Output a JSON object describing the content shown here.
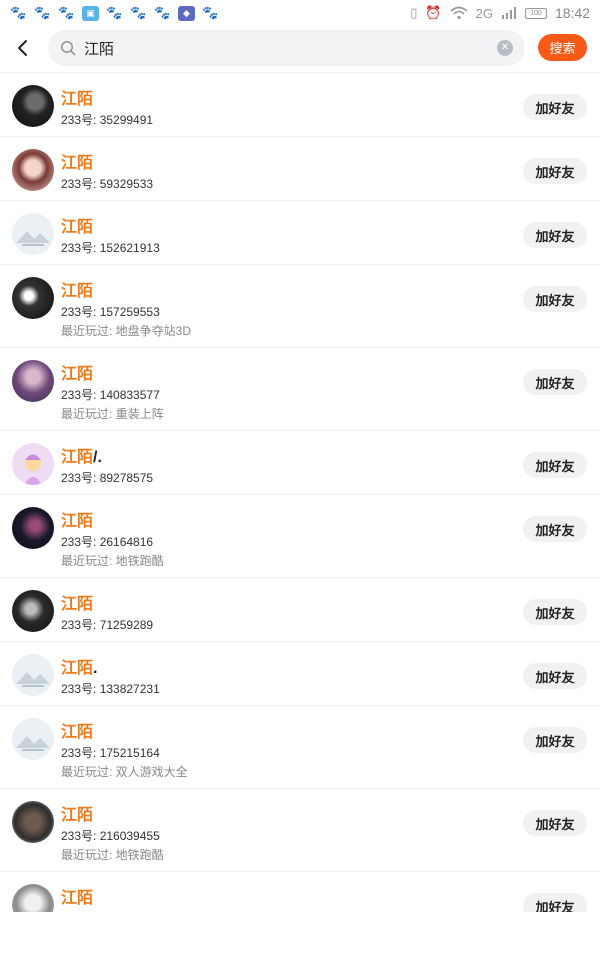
{
  "status_bar": {
    "notifications": [
      "paw-icon",
      "paw-icon",
      "paw-icon",
      "image-app-icon",
      "paw-icon",
      "paw-icon",
      "paw-icon",
      "cube-app-icon",
      "paw-icon"
    ],
    "battery": "100",
    "network": "2G",
    "time": "18:42"
  },
  "search": {
    "query": "江陌",
    "button_label": "搜索"
  },
  "results": [
    {
      "name": "江陌",
      "suffix": "",
      "uid": "233号: 35299491",
      "recent": "",
      "add_label": "加好友",
      "avatar": "dark-anime-avatar"
    },
    {
      "name": "江陌",
      "suffix": "",
      "uid": "233号: 59329533",
      "recent": "",
      "add_label": "加好友",
      "avatar": "anime-girl-avatar"
    },
    {
      "name": "江陌",
      "suffix": "",
      "uid": "233号: 152621913",
      "recent": "",
      "add_label": "加好友",
      "avatar": "default-avatar"
    },
    {
      "name": "江陌",
      "suffix": "",
      "uid": "233号: 157259553",
      "recent": "最近玩过: 地盘争夺站3D",
      "add_label": "加好友",
      "avatar": "dark-anime-avatar"
    },
    {
      "name": "江陌",
      "suffix": "",
      "uid": "233号: 140833577",
      "recent": "最近玩过: 重装上阵",
      "add_label": "加好友",
      "avatar": "purple-anime-avatar"
    },
    {
      "name": "江陌",
      "suffix": "/.",
      "uid": "233号: 89278575",
      "recent": "",
      "add_label": "加好友",
      "avatar": "pink-cartoon-avatar"
    },
    {
      "name": "江陌",
      "suffix": "",
      "uid": "233号: 26164816",
      "recent": "最近玩过: 地铁跑酷",
      "add_label": "加好友",
      "avatar": "dark-anime-avatar"
    },
    {
      "name": "江陌",
      "suffix": "",
      "uid": "233号: 71259289",
      "recent": "",
      "add_label": "加好友",
      "avatar": "dark-anime-avatar"
    },
    {
      "name": "江陌",
      "suffix": ".",
      "uid": "233号: 133827231",
      "recent": "",
      "add_label": "加好友",
      "avatar": "default-avatar"
    },
    {
      "name": "江陌",
      "suffix": "",
      "uid": "233号: 175215164",
      "recent": "最近玩过: 双人游戏大全",
      "add_label": "加好友",
      "avatar": "default-avatar"
    },
    {
      "name": "江陌",
      "suffix": "",
      "uid": "233号: 216039455",
      "recent": "最近玩过: 地铁跑酷",
      "add_label": "加好友",
      "avatar": "photo-avatar"
    },
    {
      "name": "江陌",
      "suffix": "",
      "uid": "",
      "recent": "",
      "add_label": "加好友",
      "avatar": "gray-anime-avatar"
    }
  ]
}
